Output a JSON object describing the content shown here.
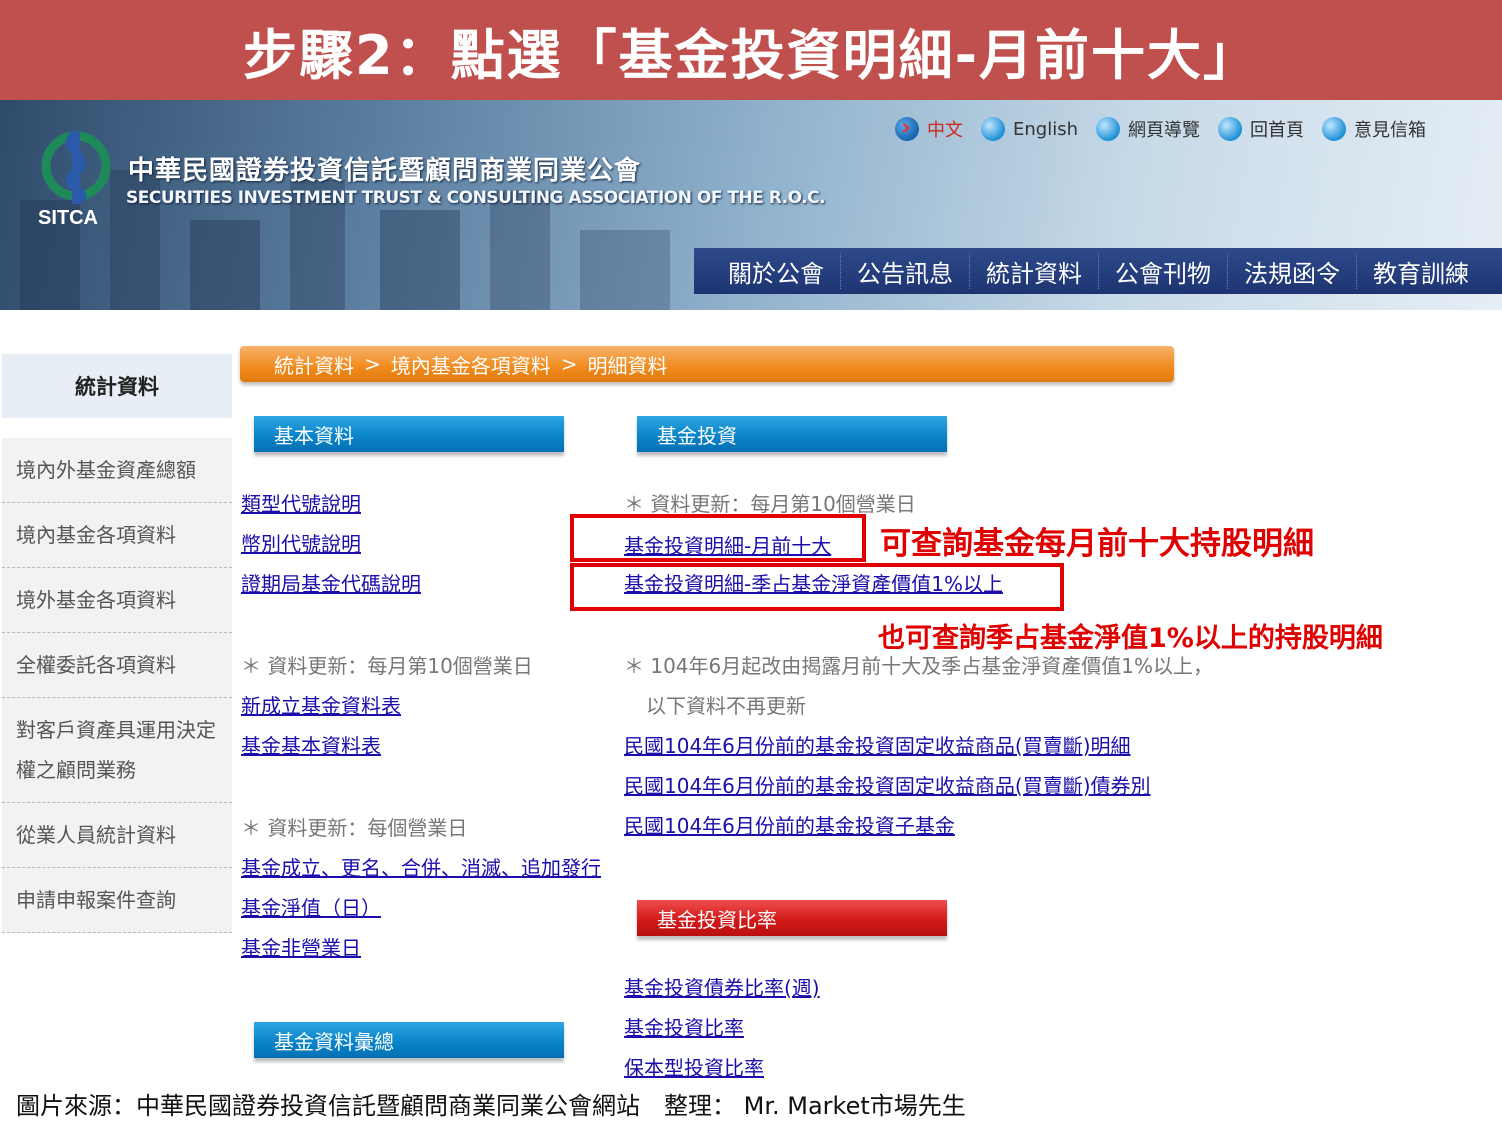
{
  "title": "步驟2：點選「基金投資明細-月前十大」",
  "header": {
    "org_name_zh": "中華民國證券投資信託暨顧問商業同業公會",
    "org_name_en": "SECURITIES INVESTMENT TRUST & CONSULTING ASSOCIATION OF THE R.O.C.",
    "logo_text": "SITCA",
    "top_links": [
      "中文",
      "English",
      "網頁導覽",
      "回首頁",
      "意見信箱"
    ],
    "nav": [
      "關於公會",
      "公告訊息",
      "統計資料",
      "公會刊物",
      "法規函令",
      "教育訓練"
    ]
  },
  "sidebar": {
    "title": "統計資料",
    "items": [
      "境內外基金資產總額",
      "境內基金各項資料",
      "境外基金各項資料",
      "全權委託各項資料",
      "對客戶資產具運用決定權之顧問業務",
      "從業人員統計資料",
      "申請申報案件查詢"
    ]
  },
  "breadcrumb": [
    "統計資料",
    ">",
    "境內基金各項資料",
    ">",
    "明細資料"
  ],
  "left_col": {
    "tab_basic": "基本資料",
    "links_a": [
      "類型代號說明",
      "幣別代號說明",
      "證期局基金代碼說明"
    ],
    "note_monthly": "＊ 資料更新：每月第10個營業日",
    "links_b": [
      "新成立基金資料表",
      "基金基本資料表"
    ],
    "note_daily": "＊ 資料更新：每個營業日",
    "links_c": [
      "基金成立、更名、合併、消滅、追加發行",
      "基金淨值（日）",
      "基金非營業日"
    ],
    "tab_summary": "基金資料彙總"
  },
  "right_col": {
    "tab_invest": "基金投資",
    "note_monthly": "＊ 資料更新：每月第10個營業日",
    "link_top10": "基金投資明細-月前十大",
    "link_quarter": "基金投資明細-季占基金淨資產價值1%以上",
    "note_change_1": "＊ 104年6月起改由揭露月前十大及季占基金淨資產價值1%以上，",
    "note_change_2": "以下資料不再更新",
    "links_old": [
      "民國104年6月份前的基金投資固定收益商品(買賣斷)明細",
      "民國104年6月份前的基金投資固定收益商品(買賣斷)債券別",
      "民國104年6月份前的基金投資子基金"
    ],
    "tab_ratio": "基金投資比率",
    "links_ratio": [
      "基金投資債券比率(週)",
      "基金投資比率",
      "保本型投資比率"
    ]
  },
  "annotations": {
    "top10": "可查詢基金每月前十大持股明細",
    "quarter": "也可查詢季占基金淨值1%以上的持股明細"
  },
  "credit": "圖片來源：中華民國證券投資信託暨顧問商業同業公會網站　整理：  Mr. Market市場先生",
  "colors": {
    "banner": "#c0504d",
    "annotation": "#e00000",
    "link": "#1a0dab"
  }
}
